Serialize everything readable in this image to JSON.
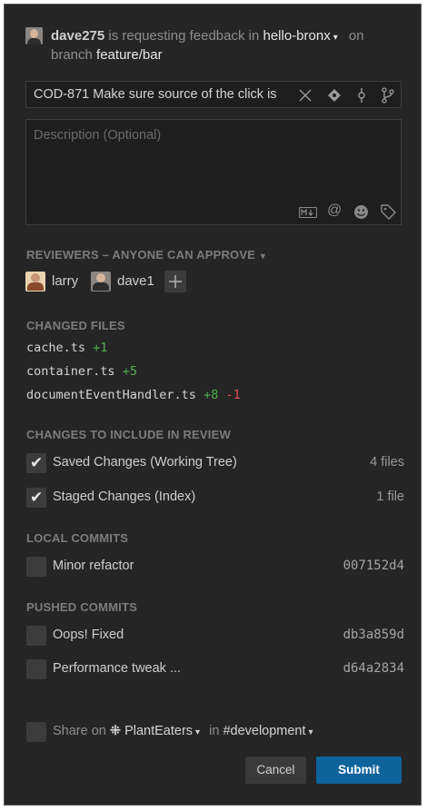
{
  "header": {
    "user": "dave275",
    "requesting_text": "is requesting feedback in",
    "repo": "hello-bronx",
    "on_text": "on",
    "branch_prefix": "branch",
    "branch": "feature/bar"
  },
  "title_input": {
    "value": "COD-871 Make sure source of the click is"
  },
  "description": {
    "placeholder": "Description (Optional)"
  },
  "reviewers": {
    "title": "REVIEWERS – ANYONE CAN APPROVE",
    "people": [
      {
        "name": "larry"
      },
      {
        "name": "dave1"
      }
    ]
  },
  "changed_files": {
    "title": "CHANGED FILES",
    "files": [
      {
        "name": "cache.ts",
        "added": "+1",
        "removed": ""
      },
      {
        "name": "container.ts",
        "added": "+5",
        "removed": ""
      },
      {
        "name": "documentEventHandler.ts",
        "added": "+8",
        "removed": "-1"
      }
    ]
  },
  "changes_to_include": {
    "title": "CHANGES TO INCLUDE IN REVIEW",
    "items": [
      {
        "label": "Saved Changes (Working Tree)",
        "detail": "4 files",
        "checked": true
      },
      {
        "label": "Staged Changes (Index)",
        "detail": "1 file",
        "checked": true
      }
    ]
  },
  "local_commits": {
    "title": "LOCAL COMMITS",
    "items": [
      {
        "label": "Minor refactor",
        "sha": "007152d4",
        "checked": false
      }
    ]
  },
  "pushed_commits": {
    "title": "PUSHED COMMITS",
    "items": [
      {
        "label": "Oops! Fixed",
        "sha": "db3a859d",
        "checked": false
      },
      {
        "label": "Performance tweak ...",
        "sha": "d64a2834",
        "checked": false
      }
    ]
  },
  "share": {
    "share_on_text": "Share on",
    "workspace": "PlantEaters",
    "in_text": "in",
    "channel": "#development"
  },
  "buttons": {
    "cancel": "Cancel",
    "submit": "Submit"
  },
  "colors": {
    "background": "#252526",
    "submit": "#0e639c",
    "added": "#4fb14f",
    "removed": "#e05050"
  }
}
